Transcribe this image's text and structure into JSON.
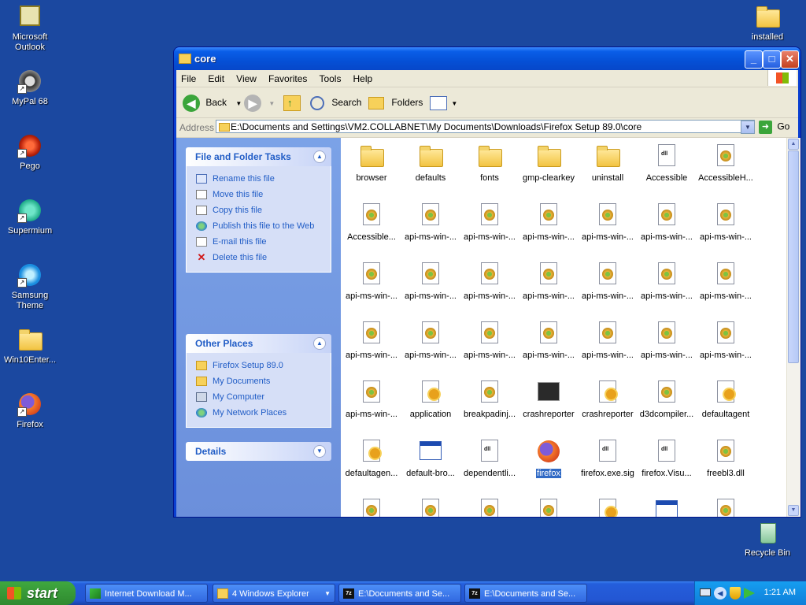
{
  "desktop": {
    "icons": [
      {
        "label": "Microsoft Outlook"
      },
      {
        "label": "MyPal 68"
      },
      {
        "label": "Pego"
      },
      {
        "label": "Supermium"
      },
      {
        "label": "Samsung Theme"
      },
      {
        "label": "Win10Enter..."
      },
      {
        "label": "Firefox"
      },
      {
        "label": "installed"
      },
      {
        "label": "Recycle Bin"
      }
    ]
  },
  "window": {
    "title": "core",
    "menu": [
      "File",
      "Edit",
      "View",
      "Favorites",
      "Tools",
      "Help"
    ],
    "toolbar": {
      "back": "Back",
      "search": "Search",
      "folders": "Folders"
    },
    "address": {
      "label": "Address",
      "value": "E:\\Documents and Settings\\VM2.COLLABNET\\My Documents\\Downloads\\Firefox Setup 89.0\\core",
      "go": "Go"
    }
  },
  "taskpane": {
    "file_tasks": {
      "title": "File and Folder Tasks",
      "items": [
        "Rename this file",
        "Move this file",
        "Copy this file",
        "Publish this file to the Web",
        "E-mail this file",
        "Delete this file"
      ]
    },
    "other_places": {
      "title": "Other Places",
      "items": [
        "Firefox Setup 89.0",
        "My Documents",
        "My Computer",
        "My Network Places"
      ]
    },
    "details": {
      "title": "Details"
    }
  },
  "files": [
    {
      "name": "browser",
      "type": "folder"
    },
    {
      "name": "defaults",
      "type": "folder"
    },
    {
      "name": "fonts",
      "type": "folder"
    },
    {
      "name": "gmp-clearkey",
      "type": "folder"
    },
    {
      "name": "uninstall",
      "type": "folder"
    },
    {
      "name": "Accessible",
      "type": "doc"
    },
    {
      "name": "AccessibleH...",
      "type": "dll"
    },
    {
      "name": "Accessible...",
      "type": "dll"
    },
    {
      "name": "api-ms-win-...",
      "type": "dll"
    },
    {
      "name": "api-ms-win-...",
      "type": "dll"
    },
    {
      "name": "api-ms-win-...",
      "type": "dll"
    },
    {
      "name": "api-ms-win-...",
      "type": "dll"
    },
    {
      "name": "api-ms-win-...",
      "type": "dll"
    },
    {
      "name": "api-ms-win-...",
      "type": "dll"
    },
    {
      "name": "api-ms-win-...",
      "type": "dll"
    },
    {
      "name": "api-ms-win-...",
      "type": "dll"
    },
    {
      "name": "api-ms-win-...",
      "type": "dll"
    },
    {
      "name": "api-ms-win-...",
      "type": "dll"
    },
    {
      "name": "api-ms-win-...",
      "type": "dll"
    },
    {
      "name": "api-ms-win-...",
      "type": "dll"
    },
    {
      "name": "api-ms-win-...",
      "type": "dll"
    },
    {
      "name": "api-ms-win-...",
      "type": "dll"
    },
    {
      "name": "api-ms-win-...",
      "type": "dll"
    },
    {
      "name": "api-ms-win-...",
      "type": "dll"
    },
    {
      "name": "api-ms-win-...",
      "type": "dll"
    },
    {
      "name": "api-ms-win-...",
      "type": "dll"
    },
    {
      "name": "api-ms-win-...",
      "type": "dll"
    },
    {
      "name": "api-ms-win-...",
      "type": "dll"
    },
    {
      "name": "api-ms-win-...",
      "type": "dll"
    },
    {
      "name": "application",
      "type": "cfg"
    },
    {
      "name": "breakpadinj...",
      "type": "dll"
    },
    {
      "name": "crashreporter",
      "type": "crash"
    },
    {
      "name": "crashreporter",
      "type": "cfg"
    },
    {
      "name": "d3dcompiler...",
      "type": "dll"
    },
    {
      "name": "defaultagent",
      "type": "cfg"
    },
    {
      "name": "defaultagen...",
      "type": "cfg"
    },
    {
      "name": "default-bro...",
      "type": "exe"
    },
    {
      "name": "dependentli...",
      "type": "doc"
    },
    {
      "name": "firefox",
      "type": "firefox",
      "selected": true
    },
    {
      "name": "firefox.exe.sig",
      "type": "doc"
    },
    {
      "name": "firefox.Visu...",
      "type": "doc"
    },
    {
      "name": "freebl3.dll",
      "type": "dll"
    },
    {
      "name": "",
      "type": "dll"
    },
    {
      "name": "",
      "type": "dll"
    },
    {
      "name": "",
      "type": "dll"
    },
    {
      "name": "",
      "type": "dll"
    },
    {
      "name": "",
      "type": "cfg"
    },
    {
      "name": "",
      "type": "exe"
    },
    {
      "name": "",
      "type": "dll"
    }
  ],
  "taskbar": {
    "start": "start",
    "buttons": [
      {
        "label": "Internet Download M..."
      },
      {
        "label": "4 Windows Explorer"
      },
      {
        "label": "E:\\Documents and Se..."
      },
      {
        "label": "E:\\Documents and Se..."
      }
    ],
    "clock": "1:21 AM"
  }
}
